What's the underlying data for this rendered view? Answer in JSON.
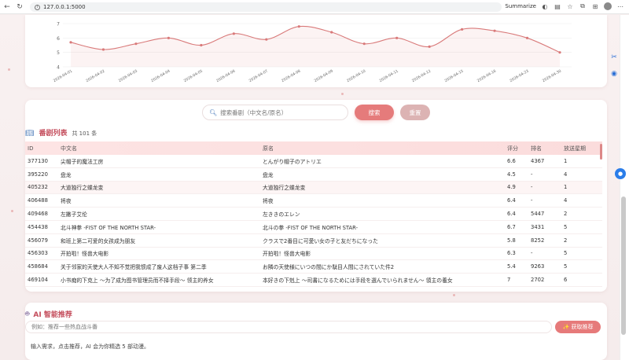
{
  "browser": {
    "url": "127.0.0.1:5000",
    "summarize_label": "Summarize"
  },
  "chart_data": {
    "type": "line",
    "x": [
      "2026-04-01",
      "2026-04-02",
      "2026-04-03",
      "2026-04-04",
      "2026-04-05",
      "2026-04-06",
      "2026-04-07",
      "2026-04-08",
      "2026-04-09",
      "2026-04-10",
      "2026-04-11",
      "2026-04-12",
      "2026-04-15",
      "2026-04-16",
      "2026-04-23",
      "2026-04-30"
    ],
    "values": [
      5.7,
      5.2,
      5.6,
      6.0,
      5.5,
      6.3,
      5.9,
      6.8,
      6.4,
      5.6,
      6.0,
      5.4,
      6.6,
      6.5,
      6.0,
      5.0
    ],
    "ylim": [
      4,
      7
    ],
    "yticks": [
      4,
      5,
      6,
      7
    ],
    "color": "#d97a7a"
  },
  "search": {
    "placeholder": "搜索番剧（中文名/原名）",
    "search_label": "搜索",
    "reset_label": "重置"
  },
  "list": {
    "title": "番剧列表",
    "count": "共 101 条",
    "columns": [
      "ID",
      "中文名",
      "原名",
      "评分",
      "排名",
      "放送星期"
    ],
    "rows": [
      [
        "377130",
        "尖帽子的魔法工房",
        "とんがり帽子のアトリエ",
        "6.6",
        "4367",
        "1"
      ],
      [
        "395220",
        "盘龙",
        "盘龙",
        "4.5",
        "-",
        "4"
      ],
      [
        "405232",
        "大道独行之蝶龙变",
        "大道独行之蝶龙变",
        "4.9",
        "-",
        "1"
      ],
      [
        "406488",
        "将夜",
        "将夜",
        "6.4",
        "-",
        "4"
      ],
      [
        "409468",
        "左撇子艾伦",
        "左ききのエレン",
        "6.4",
        "5447",
        "2"
      ],
      [
        "454438",
        "北斗神拳 -FIST OF THE NORTH STAR-",
        "北斗の拳 -FIST OF THE NORTH STAR-",
        "6.7",
        "3431",
        "5"
      ],
      [
        "456079",
        "和班上第二可爱的女孩成为朋友",
        "クラスで2番目に可愛い女の子と友だちになった",
        "5.8",
        "8252",
        "2"
      ],
      [
        "456303",
        "开拍啦！怪兽大电影",
        "开拍啦！怪兽大电影",
        "6.3",
        "-",
        "5"
      ],
      [
        "458684",
        "关于邻家的天使大人不知不觉把我惯成了废人这档子事 第二季",
        "お隣の天使様にいつの間にか駄目人間にされていた件2",
        "5.4",
        "9263",
        "5"
      ],
      [
        "469104",
        "小书痴的下克上 ～为了成为图书管理员而不择手段～ 领主的养女",
        "本好きの下剋上 ～司書になるためには手段を選んでいられません～ 領主の養女",
        "7",
        "2702",
        "6"
      ]
    ]
  },
  "ai": {
    "title": "AI 智能推荐",
    "placeholder": "例如：推荐一些热血战斗番",
    "button_label": "✨ 获取推荐",
    "hint": "输入需求，点击推荐，AI 会为你精选 5 部动漫。"
  }
}
